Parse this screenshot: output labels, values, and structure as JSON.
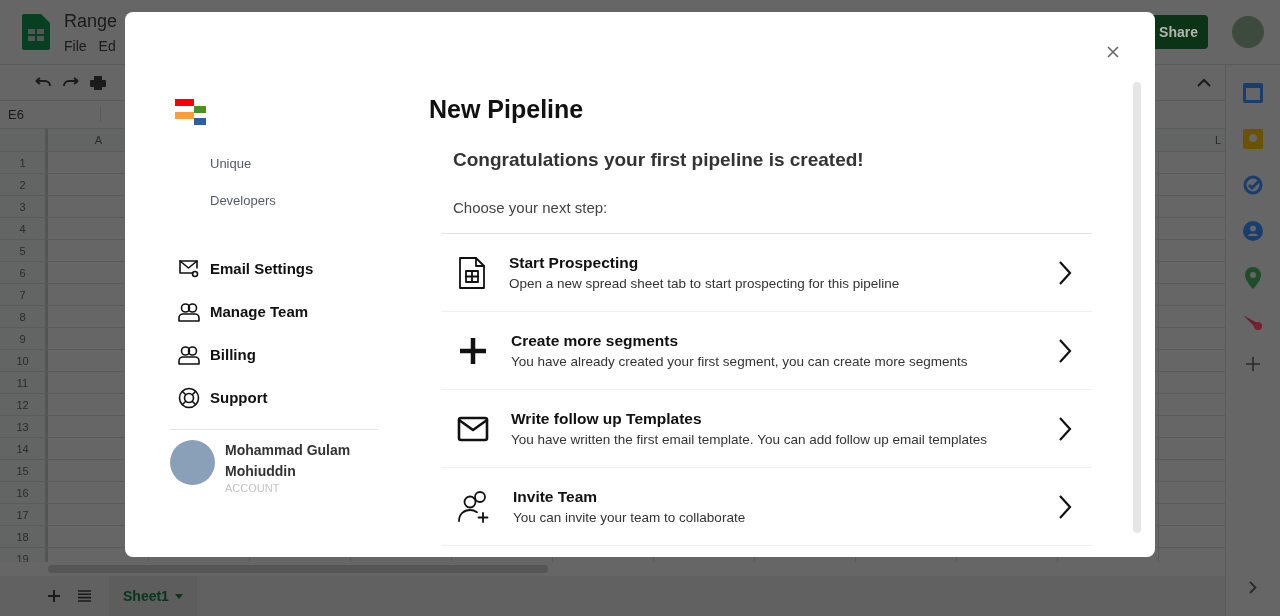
{
  "spreadsheet": {
    "title": "Range",
    "menu": [
      "File",
      "Ed"
    ],
    "share_button": "Share",
    "cell_ref": "E6",
    "columns": [
      "A",
      "L"
    ],
    "rows": [
      "1",
      "2",
      "3",
      "4",
      "5",
      "6",
      "7",
      "8",
      "9",
      "10",
      "11",
      "12",
      "13",
      "14",
      "15",
      "16",
      "17",
      "18",
      "19"
    ],
    "sheet_tab": "Sheet1"
  },
  "dialog": {
    "brand": [
      "Unique",
      "Developers"
    ],
    "nav": [
      {
        "kind": "mail-settings",
        "label": "Email Settings"
      },
      {
        "kind": "team",
        "label": "Manage Team"
      },
      {
        "kind": "team",
        "label": "Billing"
      },
      {
        "kind": "support",
        "label": "Support"
      }
    ],
    "user": {
      "name": "Mohammad Gulam Mohiuddin",
      "role": "ACCOUNT"
    },
    "title": "New Pipeline",
    "headline": "Congratulations your first pipeline is created!",
    "prompt": "Choose your next step:",
    "steps": [
      {
        "kind": "sheet",
        "title": "Start Prospecting",
        "description": "Open a new spread sheet tab to start prospecting for this pipeline"
      },
      {
        "kind": "plus",
        "title": "Create more segments",
        "description": "You have already created your first segment, you can create more segments"
      },
      {
        "kind": "mail",
        "title": "Write follow up Templates",
        "description": "You have written the first email template. You can add follow up email templates"
      },
      {
        "kind": "invite",
        "title": "Invite Team",
        "description": "You can invite your team to collaborate"
      }
    ]
  }
}
